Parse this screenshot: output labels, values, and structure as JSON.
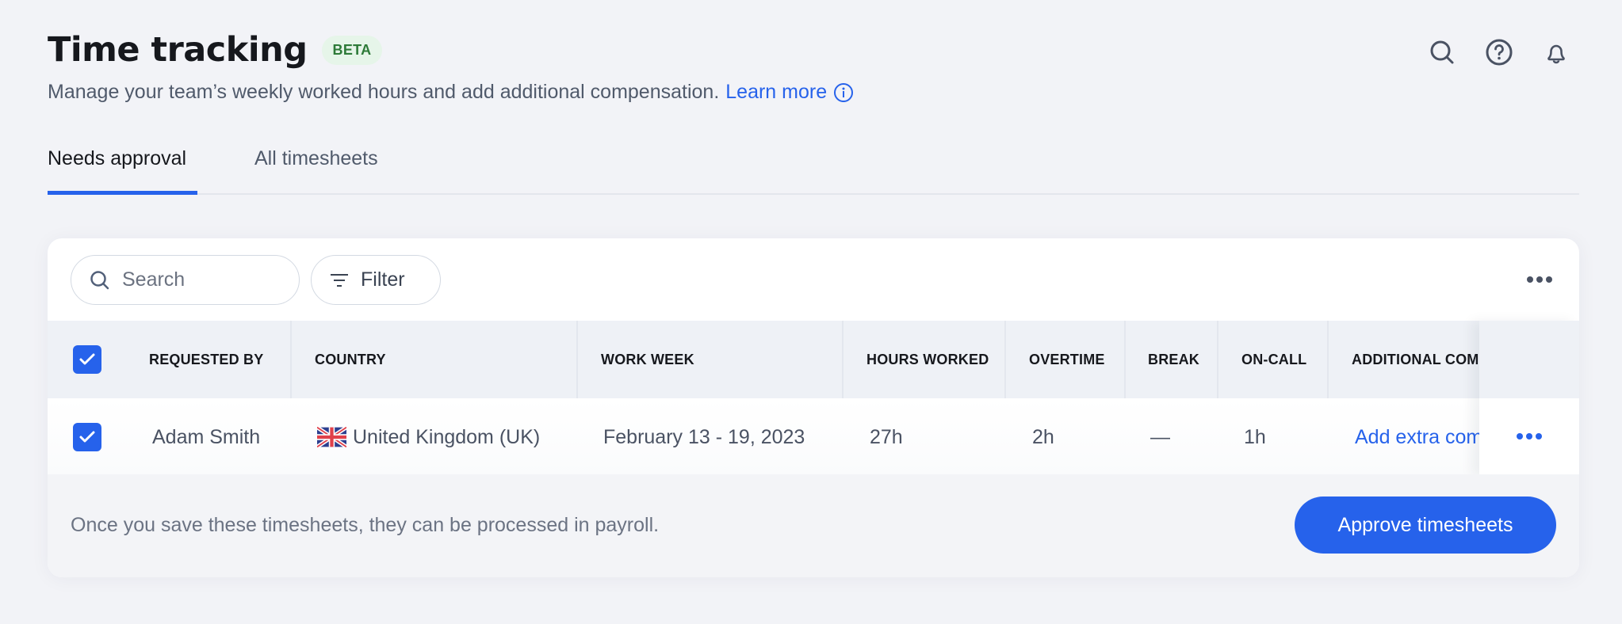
{
  "header": {
    "title": "Time tracking",
    "badge": "BETA",
    "subtitle": "Manage your team’s weekly worked hours and add additional compensation.",
    "learn_more": "Learn more",
    "icons": [
      "search-icon",
      "help-icon",
      "bell-icon"
    ]
  },
  "tabs": [
    {
      "label": "Needs approval",
      "active": true
    },
    {
      "label": "All timesheets",
      "active": false
    }
  ],
  "toolbar": {
    "search_placeholder": "Search",
    "search_value": "",
    "filter_label": "Filter"
  },
  "table": {
    "select_all_checked": true,
    "columns": [
      "REQUESTED BY",
      "COUNTRY",
      "WORK WEEK",
      "HOURS WORKED",
      "OVERTIME",
      "BREAK",
      "ON-CALL",
      "ADDITIONAL COMPENSATION"
    ],
    "rows": [
      {
        "checked": true,
        "requested_by": "Adam Smith",
        "country_flag": "uk-flag",
        "country": "United Kingdom (UK)",
        "work_week": "February 13 - 19, 2023",
        "hours_worked": "27h",
        "overtime": "2h",
        "break": "—",
        "on_call": "1h",
        "additional_compensation": "Add extra compensation"
      }
    ]
  },
  "footer": {
    "note": "Once you save these timesheets, they can be processed in payroll.",
    "approve_label": "Approve timesheets"
  },
  "colors": {
    "accent": "#2662eb",
    "beta_bg": "#e6f5e9",
    "beta_text": "#2d7a38",
    "background": "#f2f3f7"
  }
}
